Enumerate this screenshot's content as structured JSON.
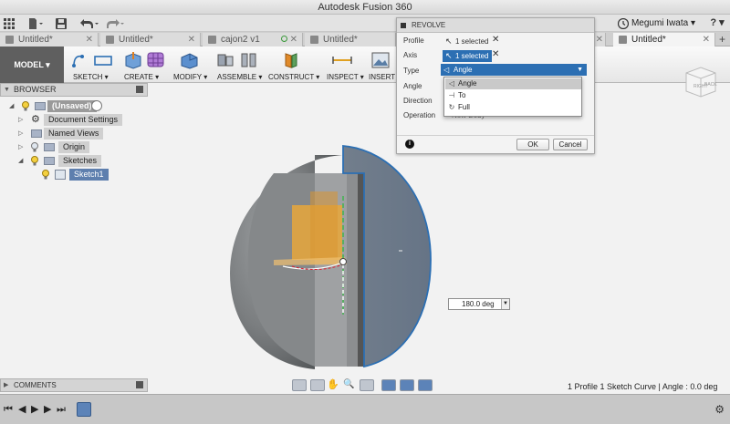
{
  "window": {
    "title": "Autodesk Fusion 360"
  },
  "quick_access": {
    "user_name": "Megumi Iwata ▾",
    "help_label": "? ▾"
  },
  "tabs": [
    {
      "label": "Untitled*",
      "active": false
    },
    {
      "label": "Untitled*",
      "active": false
    },
    {
      "label": "cajon2 v1",
      "active": false
    },
    {
      "label": "Untitled*",
      "active": false
    },
    {
      "label": "Untitled*",
      "active": true
    }
  ],
  "toolbar": {
    "workspace": "MODEL ▾",
    "groups": [
      {
        "label": "SKETCH ▾",
        "icon": "sketch-icon"
      },
      {
        "label": "CREATE ▾",
        "icon": "create-icon"
      },
      {
        "label": "MODIFY ▾",
        "icon": "modify-icon"
      },
      {
        "label": "ASSEMBLE ▾",
        "icon": "assemble-icon"
      },
      {
        "label": "CONSTRUCT ▾",
        "icon": "construct-icon"
      },
      {
        "label": "INSPECT ▾",
        "icon": "inspect-icon"
      },
      {
        "label": "INSERT ▾",
        "icon": "insert-icon"
      }
    ]
  },
  "browser": {
    "header": "BROWSER",
    "items": [
      {
        "label": "(Unsaved)"
      },
      {
        "label": "Document Settings"
      },
      {
        "label": "Named Views"
      },
      {
        "label": "Origin"
      },
      {
        "label": "Sketches"
      },
      {
        "label": "Sketch1",
        "selected": true
      }
    ]
  },
  "revolve": {
    "title": "REVOLVE",
    "profile_label": "Profile",
    "profile_value": "1 selected",
    "axis_label": "Axis",
    "axis_value": "1 selected",
    "type_label": "Type",
    "type_value": "Angle",
    "type_options": [
      "Angle",
      "To",
      "Full"
    ],
    "angle_label": "Angle",
    "direction_label": "Direction",
    "operation_label": "Operation",
    "operation_value": "New Body",
    "ok_label": "OK",
    "cancel_label": "Cancel"
  },
  "angle_input": {
    "value": "180.0 deg"
  },
  "viewcube": {
    "right_label": "RIGHT",
    "back_label": "BACK"
  },
  "comments": {
    "header": "COMMENTS"
  },
  "status": {
    "text": "1 Profile 1 Sketch Curve | Angle : 0.0 deg"
  },
  "colors": {
    "accent": "#2c6fb3",
    "model_surface": "#7d8084",
    "section_face": "#6d7f98",
    "sketch_plane": "#e8a73a",
    "selection_edge": "#2c6fb3"
  }
}
